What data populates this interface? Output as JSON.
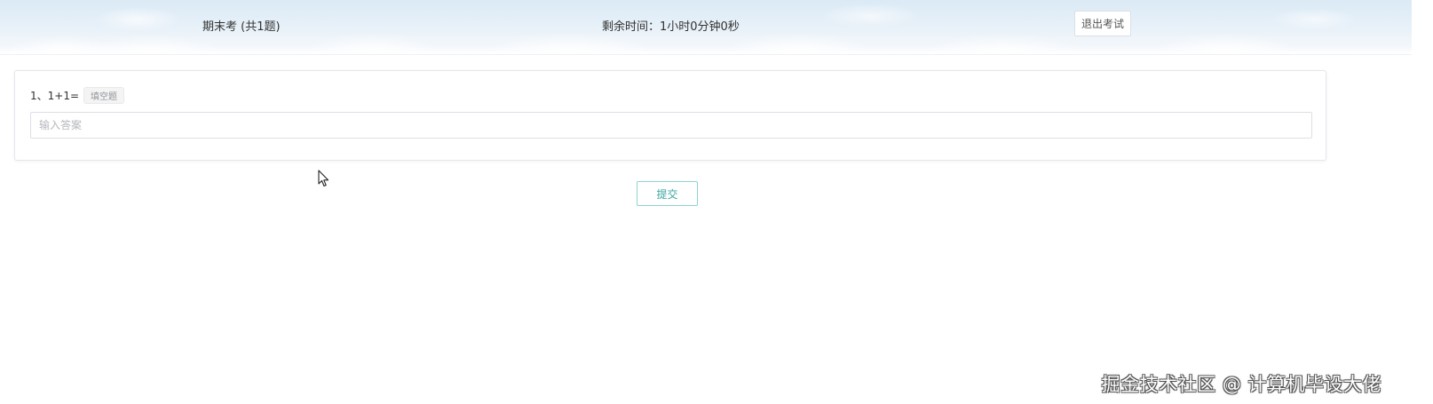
{
  "header": {
    "exam_title": "期末考 (共1题)",
    "timer_label": "剩余时间：",
    "timer_value": "1小时0分钟0秒",
    "exit_button_label": "退出考试"
  },
  "question": {
    "number": "1、",
    "text": "1+1=",
    "type_tag": "填空题",
    "answer_placeholder": "输入答案",
    "answer_value": ""
  },
  "actions": {
    "submit_label": "提交"
  },
  "watermark": {
    "text": "掘金技术社区 @ 计算机毕设大佬"
  },
  "colors": {
    "header_sky": "#dbeaf6",
    "submit_border": "#8fd3d0",
    "submit_text": "#3aa6a0",
    "tag_background": "#f4f4f5"
  },
  "icons": {
    "cursor": "mouse-pointer-icon"
  }
}
